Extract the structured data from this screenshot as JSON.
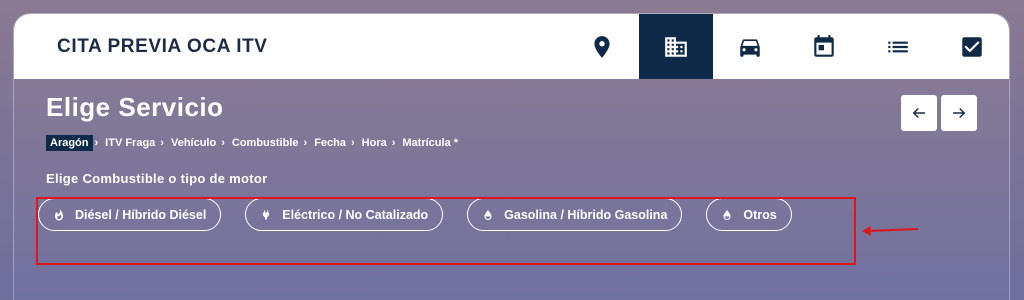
{
  "header": {
    "brand": "CITA PREVIA OCA ITV",
    "nav_icons": [
      "location-pin-icon",
      "building-icon",
      "car-icon",
      "calendar-icon",
      "list-icon",
      "checkbox-icon"
    ],
    "active_nav": "building-icon"
  },
  "main": {
    "title": "Elige Servicio",
    "breadcrumb": [
      {
        "label": "Aragón",
        "current": true
      },
      {
        "label": "ITV Fraga"
      },
      {
        "label": "Vehículo"
      },
      {
        "label": "Combustible"
      },
      {
        "label": "Fecha"
      },
      {
        "label": "Hora"
      },
      {
        "label": "Matrícula *"
      }
    ],
    "separator": "›",
    "subtitle": "Elige Combustible o tipo de motor",
    "options": [
      {
        "label": "Diésel / Híbrido Diésel",
        "icon": "flame-icon"
      },
      {
        "label": "Eléctrico / No Catalizado",
        "icon": "plug-icon"
      },
      {
        "label": "Gasolina / Híbrido Gasolina",
        "icon": "drop-icon"
      },
      {
        "label": "Otros",
        "icon": "drop-icon"
      }
    ]
  },
  "annotation": {
    "highlight_color": "#e0141c"
  },
  "colors": {
    "accent": "#0f2a48",
    "text_dark": "#1d2a45"
  }
}
